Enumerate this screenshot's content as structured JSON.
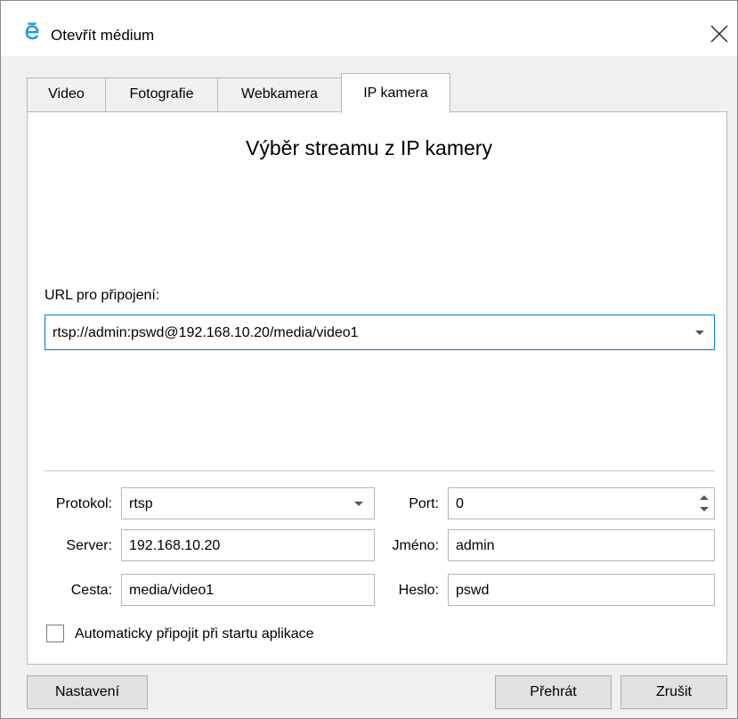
{
  "window": {
    "title": "Otevřít médium",
    "app_icon": "e-logo-icon",
    "close_icon": "close-icon"
  },
  "tabs": [
    {
      "label": "Video",
      "active": false
    },
    {
      "label": "Fotografie",
      "active": false
    },
    {
      "label": "Webkamera",
      "active": false
    },
    {
      "label": "IP kamera",
      "active": true
    }
  ],
  "panel": {
    "heading": "Výběr streamu z IP kamery",
    "url_label": "URL pro připojení:",
    "url_value": "rtsp://admin:pswd@192.168.10.20/media/video1"
  },
  "form": {
    "protocol_label": "Protokol:",
    "protocol_value": "rtsp",
    "server_label": "Server:",
    "server_value": "192.168.10.20",
    "path_label": "Cesta:",
    "path_value": "media/video1",
    "port_label": "Port:",
    "port_value": "0",
    "username_label": "Jméno:",
    "username_value": "admin",
    "password_label": "Heslo:",
    "password_value": "pswd",
    "autoconnect_label": "Automaticky připojit při startu aplikace",
    "autoconnect_checked": false
  },
  "buttons": {
    "settings": "Nastavení",
    "play": "Přehrát",
    "cancel": "Zrušit"
  },
  "colors": {
    "accent": "#0078d7",
    "logo": "#1e9ed9"
  }
}
